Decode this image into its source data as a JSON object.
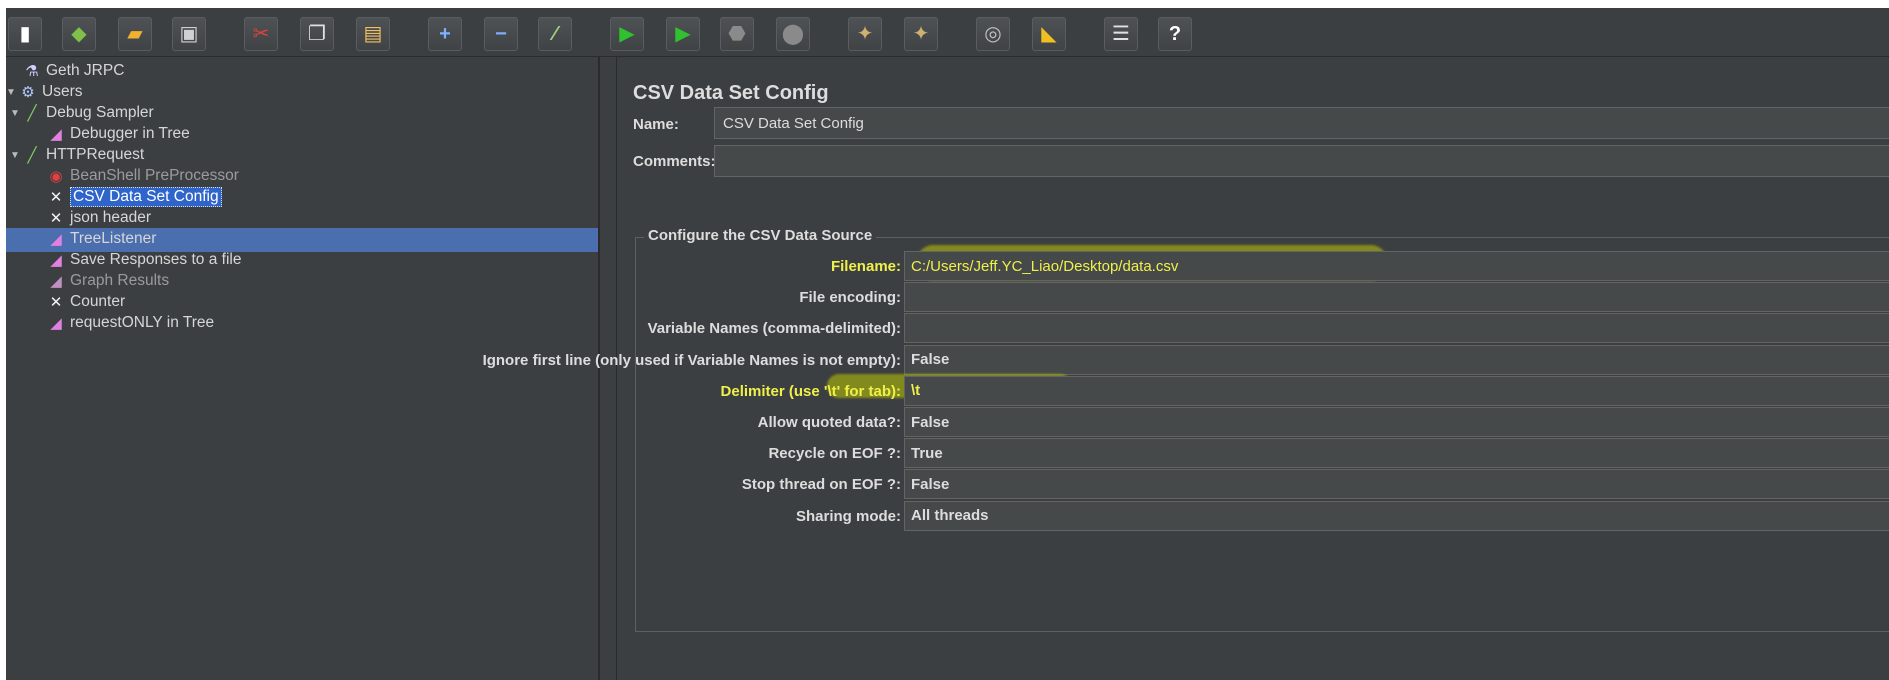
{
  "toolbar": {
    "buttons": [
      {
        "name": "new",
        "icon": "new-document-icon",
        "glyph": "▮",
        "color": "#ffffff"
      },
      {
        "name": "templates",
        "icon": "templates-icon",
        "glyph": "◆",
        "color": "#7fbf4a"
      },
      {
        "name": "open",
        "icon": "open-folder-icon",
        "glyph": "▰",
        "color": "#f0b030"
      },
      {
        "name": "save",
        "icon": "save-icon",
        "glyph": "▣",
        "color": "#d0d0d0"
      },
      {
        "name": "cut",
        "icon": "cut-icon",
        "glyph": "✂",
        "color": "#e04040"
      },
      {
        "name": "copy",
        "icon": "copy-icon",
        "glyph": "❐",
        "color": "#e0e0e0"
      },
      {
        "name": "paste",
        "icon": "paste-icon",
        "glyph": "▤",
        "color": "#f0c060"
      },
      {
        "name": "expand",
        "icon": "plus-icon",
        "glyph": "+",
        "color": "#7fb0ff"
      },
      {
        "name": "collapse",
        "icon": "minus-icon",
        "glyph": "−",
        "color": "#7fb0ff"
      },
      {
        "name": "toggle",
        "icon": "toggle-icon",
        "glyph": "⁄",
        "color": "#a0d080"
      },
      {
        "name": "start",
        "icon": "play-icon",
        "glyph": "▶",
        "color": "#30c030"
      },
      {
        "name": "start-no-pauses",
        "icon": "play-no-pause-icon",
        "glyph": "▶",
        "color": "#30c030"
      },
      {
        "name": "stop",
        "icon": "stop-icon",
        "glyph": "⬣",
        "color": "#8a8a8a"
      },
      {
        "name": "shutdown",
        "icon": "shutdown-icon",
        "glyph": "⬤",
        "color": "#8a8a8a"
      },
      {
        "name": "clear",
        "icon": "clear-broom-icon",
        "glyph": "✦",
        "color": "#d0b070"
      },
      {
        "name": "clear-all",
        "icon": "clear-all-broom-icon",
        "glyph": "✦",
        "color": "#d0b070"
      },
      {
        "name": "search",
        "icon": "binoculars-icon",
        "glyph": "◎",
        "color": "#c0c0c0"
      },
      {
        "name": "reset-search",
        "icon": "reset-search-icon",
        "glyph": "◣",
        "color": "#f0c020"
      },
      {
        "name": "function-helper",
        "icon": "function-helper-icon",
        "glyph": "☰",
        "color": "#e0e0e0"
      },
      {
        "name": "help",
        "icon": "help-icon",
        "glyph": "?",
        "color": "#ffffff"
      }
    ]
  },
  "tree": {
    "items": [
      {
        "label": "Geth JRPC",
        "icon": "test-plan-icon",
        "glyph": "⚗",
        "color": "#d0d0ff",
        "arrow": ""
      },
      {
        "label": "Users",
        "icon": "thread-group-gear-icon",
        "glyph": "⚙",
        "color": "#b0c8ff",
        "arrow": "▼"
      },
      {
        "label": "Debug Sampler",
        "icon": "sampler-pipette-icon",
        "glyph": "╱",
        "color": "#80d060",
        "arrow": "▼"
      },
      {
        "label": "Debugger in Tree",
        "icon": "listener-graph-icon",
        "glyph": "◢",
        "color": "#e080e0",
        "arrow": ""
      },
      {
        "label": "HTTPRequest",
        "icon": "sampler-pipette-icon",
        "glyph": "╱",
        "color": "#80d060",
        "arrow": "▼"
      },
      {
        "label": "BeanShell PreProcessor",
        "icon": "preprocessor-icon",
        "glyph": "◉",
        "color": "#e04040",
        "arrow": ""
      },
      {
        "label": "CSV Data Set Config",
        "icon": "config-wrench-icon",
        "glyph": "✕",
        "color": "#f0f0f0",
        "arrow": ""
      },
      {
        "label": "json header",
        "icon": "config-wrench-icon",
        "glyph": "✕",
        "color": "#f0f0f0",
        "arrow": ""
      },
      {
        "label": "TreeListener",
        "icon": "listener-graph-icon",
        "glyph": "◢",
        "color": "#e080e0",
        "arrow": ""
      },
      {
        "label": "Save Responses to a file",
        "icon": "listener-graph-icon",
        "glyph": "◢",
        "color": "#e080e0",
        "arrow": ""
      },
      {
        "label": "Graph Results",
        "icon": "listener-graph-icon",
        "glyph": "◢",
        "color": "#c090c0",
        "arrow": ""
      },
      {
        "label": "Counter",
        "icon": "config-wrench-icon",
        "glyph": "✕",
        "color": "#f0f0f0",
        "arrow": ""
      },
      {
        "label": "requestONLY in Tree",
        "icon": "listener-graph-icon",
        "glyph": "◢",
        "color": "#e080e0",
        "arrow": ""
      }
    ]
  },
  "panel": {
    "title": "CSV Data Set Config",
    "name_label": "Name:",
    "name_value": "CSV Data Set Config",
    "comments_label": "Comments:",
    "comments_value": "",
    "group_title": "Configure the CSV Data Source",
    "rows": [
      {
        "label": "Filename:",
        "value": "C:/Users/Jeff.YC_Liao/Desktop/data.csv",
        "highlight": true
      },
      {
        "label": "File encoding:",
        "value": "",
        "highlight": false
      },
      {
        "label": "Variable Names (comma-delimited):",
        "value": "",
        "highlight": false
      },
      {
        "label": "Ignore first line (only used if Variable Names is not empty):",
        "value": "False",
        "highlight": false
      },
      {
        "label": "Delimiter (use '\\t' for tab):",
        "value": "\\t",
        "highlight": true
      },
      {
        "label": "Allow quoted data?:",
        "value": "False",
        "highlight": false
      },
      {
        "label": "Recycle on EOF ?:",
        "value": "True",
        "highlight": false
      },
      {
        "label": "Stop thread on EOF ?:",
        "value": "False",
        "highlight": false
      },
      {
        "label": "Sharing mode:",
        "value": "All threads",
        "highlight": false
      }
    ]
  }
}
